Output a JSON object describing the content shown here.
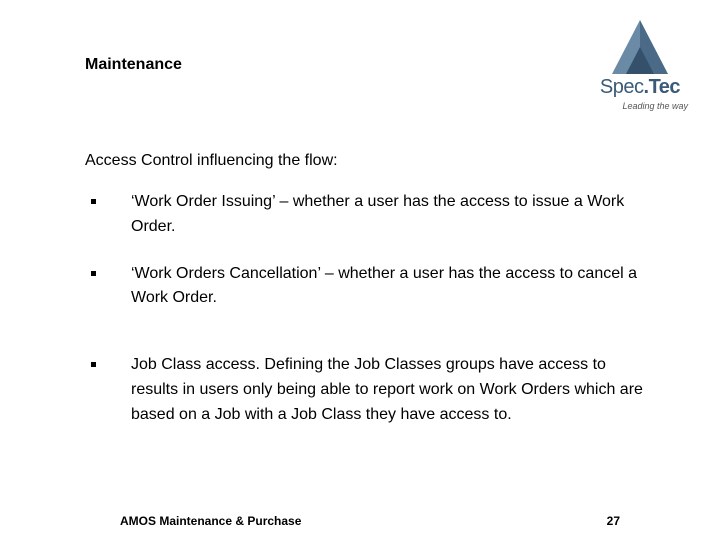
{
  "title": "Maintenance",
  "logo": {
    "spec": "Spec",
    "dot": ".",
    "tec": "Tec",
    "tagline": "Leading the way"
  },
  "lead": "Access Control influencing the flow:",
  "bullets": [
    "‘Work Order Issuing’ – whether a user has the access to issue a Work Order.",
    "‘Work Orders Cancellation’ – whether a user has the access to cancel a Work Order.",
    "Job Class access. Defining the Job Classes groups have access to results in users only being able to report work on Work Orders which are based on a Job with a Job Class they have access to."
  ],
  "footer": {
    "left": "AMOS Maintenance & Purchase",
    "page": "27"
  }
}
